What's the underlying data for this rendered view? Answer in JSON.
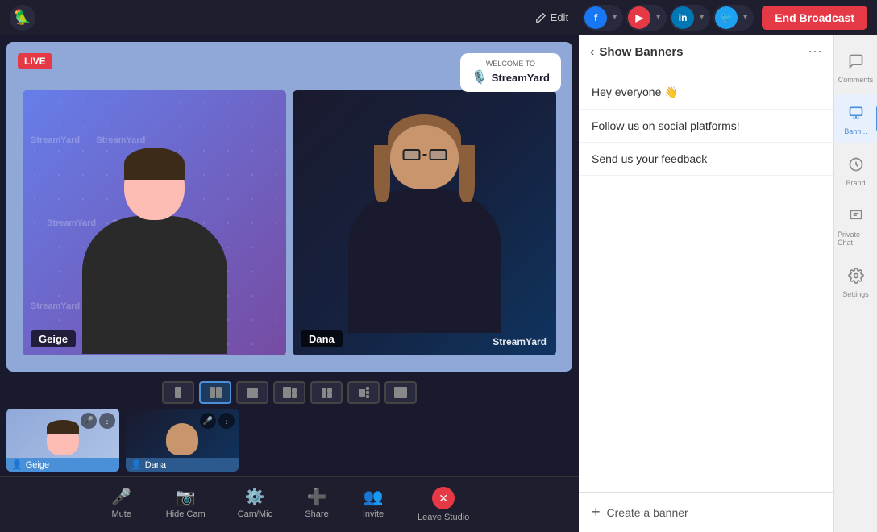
{
  "topbar": {
    "edit_label": "Edit",
    "end_broadcast_label": "End Broadcast",
    "avatars": [
      {
        "id": "fb",
        "color": "#1877f2",
        "letter": "F",
        "label": ""
      },
      {
        "id": "yt",
        "color": "#e63946",
        "letter": "Y",
        "label": ""
      },
      {
        "id": "li",
        "color": "#0077b5",
        "letter": "in",
        "label": ""
      },
      {
        "id": "tw",
        "color": "#1da1f2",
        "letter": "T",
        "label": ""
      }
    ]
  },
  "broadcast": {
    "live_badge": "LIVE",
    "streamyard_welcome": "WELCOME TO",
    "streamyard_brand": "StreamYard",
    "person1": {
      "name": "Geige"
    },
    "person2": {
      "name": "Dana"
    }
  },
  "layout_options": [
    "single-left",
    "split-2",
    "side-by-side",
    "interview",
    "grid-4",
    "wide",
    "full"
  ],
  "toolbar": {
    "mute_label": "Mute",
    "hide_cam_label": "Hide Cam",
    "cam_mic_label": "Cam/Mic",
    "share_label": "Share",
    "invite_label": "Invite",
    "leave_label": "Leave Studio"
  },
  "right_panel": {
    "header": {
      "back_label": "‹",
      "title": "Show Banners",
      "more_label": "⋯"
    },
    "banners": [
      {
        "id": 1,
        "text": "Hey everyone 👋"
      },
      {
        "id": 2,
        "text": "Follow us on social platforms!"
      },
      {
        "id": 3,
        "text": "Send us your feedback"
      }
    ],
    "create_banner_label": "Create a banner"
  },
  "tab_sidebar": {
    "tabs": [
      {
        "id": "comments",
        "label": "Comments",
        "active": false
      },
      {
        "id": "banners",
        "label": "Bann...",
        "active": true
      },
      {
        "id": "brand",
        "label": "Brand",
        "active": false
      },
      {
        "id": "private-chat",
        "label": "Private Chat",
        "active": false
      },
      {
        "id": "settings",
        "label": "Settings",
        "active": false
      }
    ]
  }
}
